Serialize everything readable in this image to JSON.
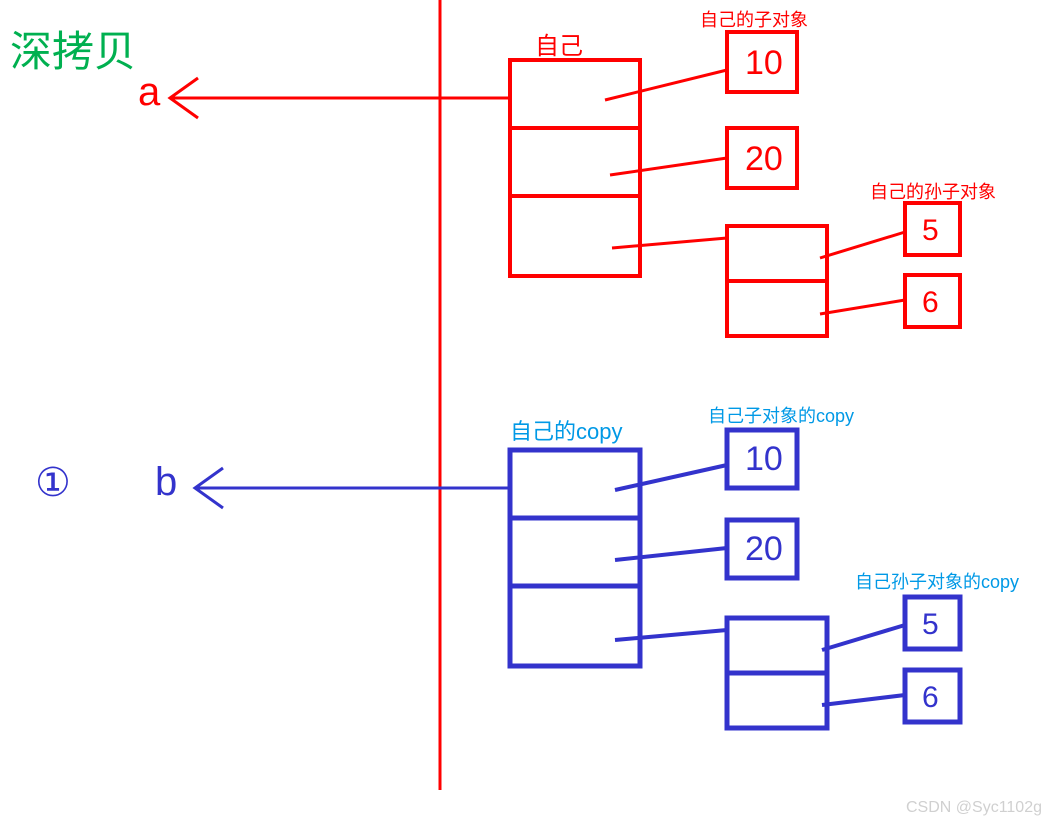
{
  "title": "深拷贝",
  "circled": "①",
  "a": {
    "var": "a",
    "self_label": "自己",
    "child_label": "自己的子对象",
    "grandchild_label": "自己的孙子对象",
    "children": [
      "10",
      "20"
    ],
    "grandchildren": [
      "5",
      "6"
    ]
  },
  "b": {
    "var": "b",
    "self_label": "自己的copy",
    "child_label": "自己子对象的copy",
    "grandchild_label": "自己孙子对象的copy",
    "children": [
      "10",
      "20"
    ],
    "grandchildren": [
      "5",
      "6"
    ]
  },
  "watermark": "CSDN @Syc1102g",
  "colors": {
    "red": "#ff0000",
    "blue": "#3333cc",
    "green": "#00b050",
    "cyanlabel": "#0099e6"
  }
}
